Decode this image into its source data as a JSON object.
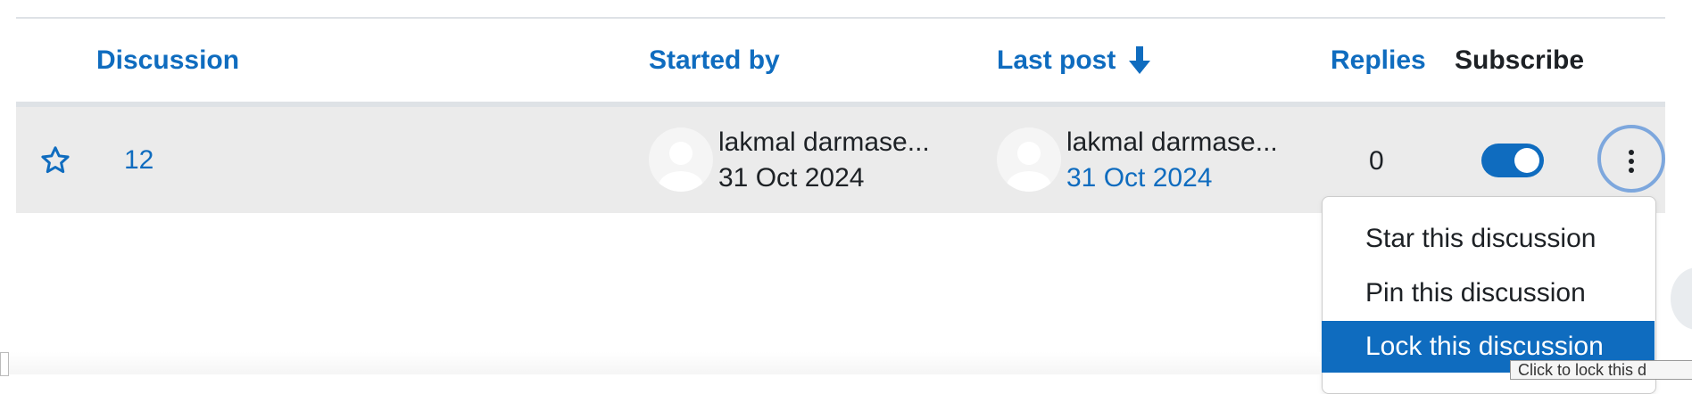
{
  "table": {
    "headers": {
      "discussion": "Discussion",
      "started_by": "Started by",
      "last_post": "Last post",
      "replies": "Replies",
      "subscribe": "Subscribe"
    },
    "sort_icon": "arrow-down-icon",
    "rows": [
      {
        "discussion": "12",
        "starred": false,
        "started_by": {
          "name": "lakmal darmase...",
          "date": "31 Oct 2024"
        },
        "last_post": {
          "name": "lakmal darmase...",
          "date": "31 Oct 2024"
        },
        "replies": "0",
        "subscribed": true
      }
    ]
  },
  "menu": {
    "items": [
      {
        "label": "Star this discussion"
      },
      {
        "label": "Pin this discussion"
      },
      {
        "label": "Lock this discussion"
      }
    ],
    "active_index": 2
  },
  "tooltip": {
    "text": "Click to lock this d"
  },
  "colors": {
    "accent": "#0f6cbf",
    "row_bg": "#ebebeb",
    "text": "#1d2125"
  }
}
